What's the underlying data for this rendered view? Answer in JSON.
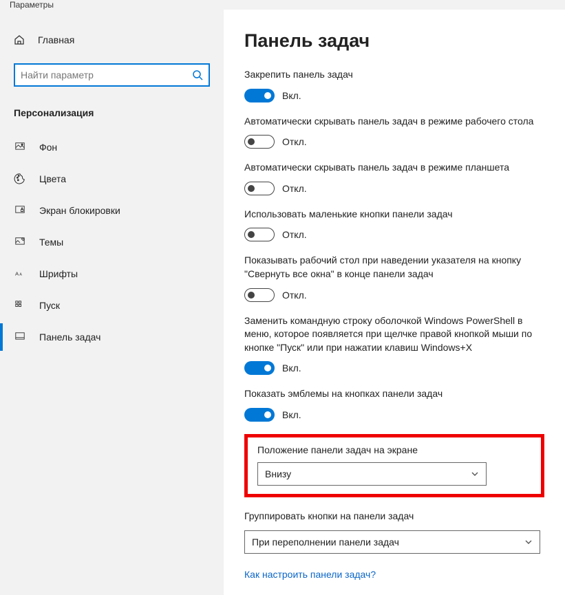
{
  "window": {
    "title": "Параметры"
  },
  "sidebar": {
    "home": "Главная",
    "search_placeholder": "Найти параметр",
    "category": "Персонализация",
    "items": [
      {
        "label": "Фон"
      },
      {
        "label": "Цвета"
      },
      {
        "label": "Экран блокировки"
      },
      {
        "label": "Темы"
      },
      {
        "label": "Шрифты"
      },
      {
        "label": "Пуск"
      },
      {
        "label": "Панель задач"
      }
    ]
  },
  "main": {
    "title": "Панель задач",
    "settings": [
      {
        "label": "Закрепить панель задач",
        "state": "Вкл.",
        "on": true
      },
      {
        "label": "Автоматически скрывать панель задач в режиме рабочего стола",
        "state": "Откл.",
        "on": false
      },
      {
        "label": "Автоматически скрывать панель задач в режиме планшета",
        "state": "Откл.",
        "on": false
      },
      {
        "label": "Использовать маленькие кнопки панели задач",
        "state": "Откл.",
        "on": false
      },
      {
        "label": "Показывать рабочий стол при наведении указателя на кнопку \"Свернуть все окна\" в конце панели задач",
        "state": "Откл.",
        "on": false
      },
      {
        "label": "Заменить командную строку оболочкой Windows PowerShell в меню, которое появляется при щелчке правой кнопкой мыши по кнопке \"Пуск\" или при нажатии клавиш Windows+X",
        "state": "Вкл.",
        "on": true
      },
      {
        "label": "Показать эмблемы на кнопках панели задач",
        "state": "Вкл.",
        "on": true
      }
    ],
    "position": {
      "label": "Положение панели задач на экране",
      "value": "Внизу"
    },
    "grouping": {
      "label": "Группировать кнопки на панели задач",
      "value": "При переполнении панели задач"
    },
    "help_link": "Как настроить панели задач?"
  }
}
